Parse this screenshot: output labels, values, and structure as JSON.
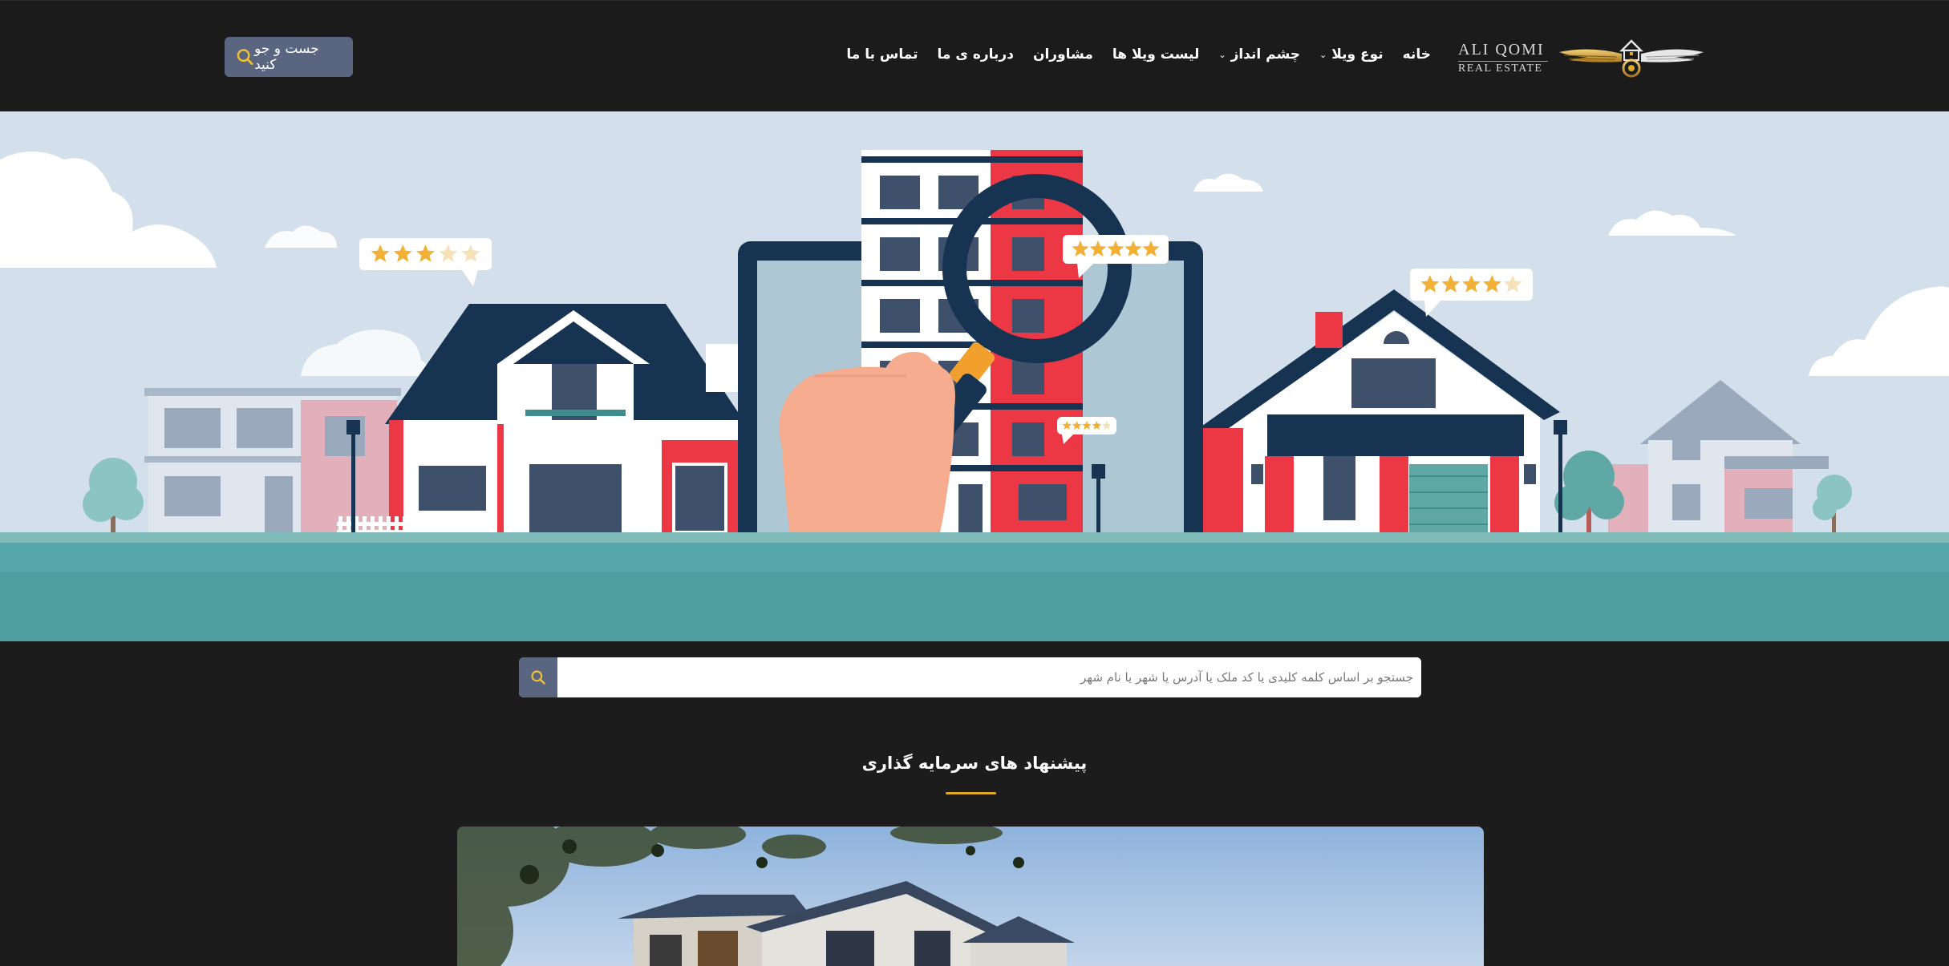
{
  "brand": {
    "line1": "ALI  QOMI",
    "line2": "REAL ESTATE"
  },
  "nav": {
    "items": [
      {
        "label": "خانه",
        "dropdown": false
      },
      {
        "label": "نوع ویلا",
        "dropdown": true
      },
      {
        "label": "چشم انداز",
        "dropdown": true
      },
      {
        "label": "لیست ویلا ها",
        "dropdown": false
      },
      {
        "label": "مشاوران",
        "dropdown": false
      },
      {
        "label": "درباره ی ما",
        "dropdown": false
      },
      {
        "label": "تماس با ما",
        "dropdown": false
      }
    ]
  },
  "header_search": {
    "label": "جست و جو کنید",
    "icon": "search-icon"
  },
  "main_search": {
    "placeholder": "جستجو بر اساس کلمه کلیدی یا کد ملک یا آدرس یا شهر یا نام شهر",
    "icon": "search-icon"
  },
  "section": {
    "title": "پیشنهاد های سرمایه گذاری"
  },
  "hero": {
    "ratings": [
      3,
      5,
      4,
      4
    ]
  },
  "colors": {
    "header_bg": "#1b1b1b",
    "page_bg": "#1c1c1c",
    "accent_gold": "#e0a928",
    "button_slate": "#5a6580",
    "navy": "#163452",
    "red": "#ec3745",
    "teal": "#55a6a8",
    "sky": "#d3dfea"
  }
}
